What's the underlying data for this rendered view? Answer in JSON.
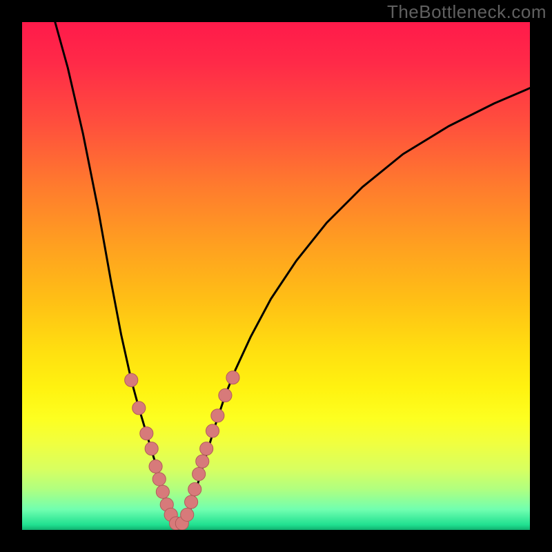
{
  "watermark": "TheBottleneck.com",
  "colors": {
    "curve_stroke": "#000000",
    "dot_fill": "#d77a7a",
    "dot_stroke": "#b25b5b"
  },
  "chart_data": {
    "type": "line",
    "title": "",
    "xlabel": "",
    "ylabel": "",
    "xlim": [
      0,
      100
    ],
    "ylim": [
      0,
      100
    ],
    "note": "x,y are in percent of inner plot area (0,0 = top-left). Curve is a V-shaped bottleneck profile with minimum near x≈30.",
    "series": [
      {
        "name": "bottleneck-curve",
        "points": [
          {
            "x": 6.5,
            "y": 0.0
          },
          {
            "x": 9.0,
            "y": 9.0
          },
          {
            "x": 12.0,
            "y": 22.0
          },
          {
            "x": 15.0,
            "y": 37.0
          },
          {
            "x": 17.5,
            "y": 51.0
          },
          {
            "x": 19.5,
            "y": 61.5
          },
          {
            "x": 21.5,
            "y": 70.5
          },
          {
            "x": 23.0,
            "y": 76.0
          },
          {
            "x": 24.5,
            "y": 81.0
          },
          {
            "x": 26.0,
            "y": 86.0
          },
          {
            "x": 27.0,
            "y": 89.5
          },
          {
            "x": 28.0,
            "y": 93.0
          },
          {
            "x": 29.0,
            "y": 96.5
          },
          {
            "x": 30.0,
            "y": 99.0
          },
          {
            "x": 31.0,
            "y": 99.5
          },
          {
            "x": 32.0,
            "y": 99.0
          },
          {
            "x": 33.0,
            "y": 96.5
          },
          {
            "x": 34.0,
            "y": 93.0
          },
          {
            "x": 35.0,
            "y": 89.5
          },
          {
            "x": 36.5,
            "y": 84.5
          },
          {
            "x": 38.0,
            "y": 79.5
          },
          {
            "x": 40.0,
            "y": 73.5
          },
          {
            "x": 42.0,
            "y": 68.5
          },
          {
            "x": 45.0,
            "y": 62.0
          },
          {
            "x": 49.0,
            "y": 54.5
          },
          {
            "x": 54.0,
            "y": 47.0
          },
          {
            "x": 60.0,
            "y": 39.5
          },
          {
            "x": 67.0,
            "y": 32.5
          },
          {
            "x": 75.0,
            "y": 26.0
          },
          {
            "x": 84.0,
            "y": 20.5
          },
          {
            "x": 93.0,
            "y": 16.0
          },
          {
            "x": 100.0,
            "y": 13.0
          }
        ]
      }
    ],
    "dots": [
      {
        "x": 21.5,
        "y": 70.5
      },
      {
        "x": 23.0,
        "y": 76.0
      },
      {
        "x": 24.5,
        "y": 81.0
      },
      {
        "x": 25.5,
        "y": 84.0
      },
      {
        "x": 26.3,
        "y": 87.5
      },
      {
        "x": 27.0,
        "y": 90.0
      },
      {
        "x": 27.7,
        "y": 92.5
      },
      {
        "x": 28.5,
        "y": 95.0
      },
      {
        "x": 29.3,
        "y": 97.0
      },
      {
        "x": 30.3,
        "y": 98.7
      },
      {
        "x": 31.5,
        "y": 98.7
      },
      {
        "x": 32.5,
        "y": 97.0
      },
      {
        "x": 33.3,
        "y": 94.5
      },
      {
        "x": 34.0,
        "y": 92.0
      },
      {
        "x": 34.8,
        "y": 89.0
      },
      {
        "x": 35.5,
        "y": 86.5
      },
      {
        "x": 36.3,
        "y": 84.0
      },
      {
        "x": 37.5,
        "y": 80.5
      },
      {
        "x": 38.5,
        "y": 77.5
      },
      {
        "x": 40.0,
        "y": 73.5
      },
      {
        "x": 41.5,
        "y": 70.0
      }
    ],
    "dot_radius_pct": 1.3
  }
}
